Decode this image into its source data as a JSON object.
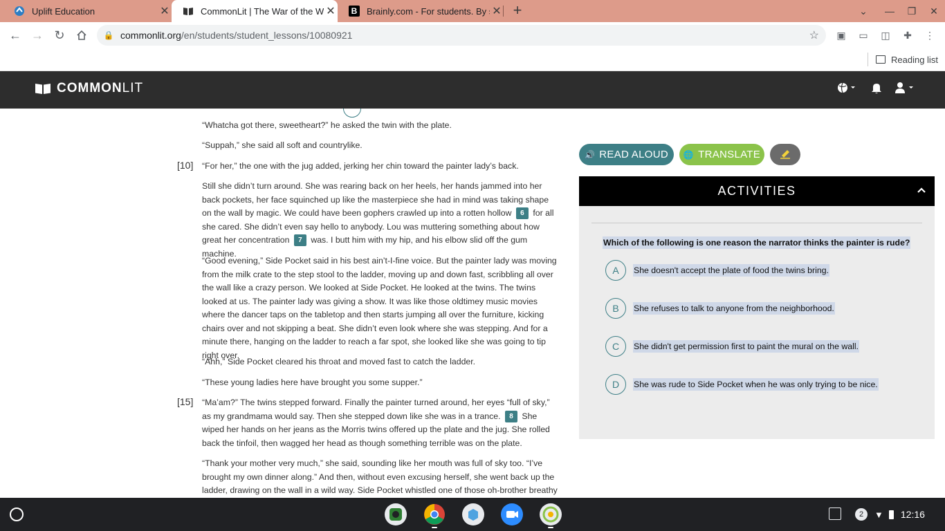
{
  "browser": {
    "tabs": [
      {
        "title": "Uplift Education",
        "active": false
      },
      {
        "title": "CommonLit | The War of the Wa",
        "active": true
      },
      {
        "title": "Brainly.com - For students. By st",
        "active": false
      }
    ],
    "url_host": "commonlit.org",
    "url_path": "/en/students/student_lessons/10080921",
    "reading_list": "Reading list"
  },
  "header": {
    "logo_bold": "COMMON",
    "logo_light": "LIT"
  },
  "passage": {
    "p1": "“Whatcha got there, sweetheart?” he asked the twin with the plate.",
    "p2": "“Suppah,” she said all soft and countrylike.",
    "p3_num": "[10]",
    "p3": "“For her,” the one with the jug added, jerking her chin toward the painter lady’s back.",
    "p4_a": "Still she didn’t turn around. She was rearing back on her heels, her hands jammed into her back pockets, her face squinched up like the masterpiece she had in mind was taking shape on the wall by magic. We could have been gophers crawled up into a rotten hollow",
    "p4_g1": "6",
    "p4_b": " for all she cared. She didn’t even say hello to anybody. Lou was muttering something about how great her concentration",
    "p4_g2": "7",
    "p4_c": " was. I butt him with my hip, and his elbow slid off the gum machine.",
    "p5": "“Good evening,” Side Pocket said in his best ain’t-I-fine voice. But the painter lady was moving from the milk crate to the step stool to the ladder, moving up and down fast, scribbling all over the wall like a crazy person. We looked at Side Pocket. He looked at the twins. The twins looked at us. The painter lady was giving a show. It was like those oldtimey music movies where the dancer taps on the tabletop and then starts jumping all over the furniture, kicking chairs over and not skipping a beat. She didn’t even look where she was stepping. And for a minute there, hanging on the ladder to reach a far spot, she looked like she was going to tip right over.",
    "p6": "“Ahh,” Side Pocket cleared his throat and moved fast to catch the ladder.",
    "p7": "“These young ladies here have brought you some supper.”",
    "p8_num": "[15]",
    "p8_a": "“Ma’am?” The twins stepped forward. Finally the painter turned around, her eyes “full of sky,” as my grandmama would say. Then she stepped down like she was in a trance.",
    "p8_g": "8",
    "p8_b": " She wiped her hands on her jeans as the Morris twins offered up the plate and the jug. She rolled back the tinfoil, then wagged her head as though something terrible was on the plate.",
    "p9": "“Thank your mother very much,” she said, sounding like her mouth was full of sky too. “I’ve brought my own dinner along.” And then, without even excusing herself, she went back up the ladder, drawing on the wall in a wild way. Side Pocket whistled one of those oh-brother breathy whistles"
  },
  "tools": {
    "read_aloud": "READ ALOUD",
    "translate": "TRANSLATE"
  },
  "activities": {
    "title": "ACTIVITIES",
    "question": "Which of the following is one reason the narrator thinks the painter is rude?",
    "choices": [
      {
        "letter": "A",
        "text": "She doesn't accept the plate of food the twins bring."
      },
      {
        "letter": "B",
        "text": "She refuses to talk to anyone from the neighborhood."
      },
      {
        "letter": "C",
        "text": "She didn't get permission first to paint the mural on the wall."
      },
      {
        "letter": "D",
        "text": "She was rude to Side Pocket when he was only trying to be nice."
      }
    ]
  },
  "shelf": {
    "notification_count": "2",
    "time": "12:16"
  },
  "colors": {
    "teal": "#3d7f86",
    "green": "#8bc34a",
    "tabstrip": "#dd9b8a"
  }
}
